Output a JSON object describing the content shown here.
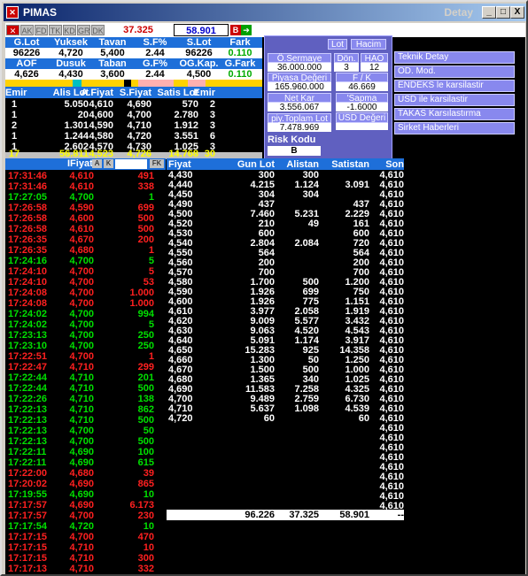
{
  "window": {
    "title": "PIMAS",
    "subtitle": "Detay",
    "btn_min": "_",
    "btn_max": "□",
    "btn_close": "X"
  },
  "toolbar": {
    "tabs": [
      "AK",
      "FD",
      "TK",
      "KD",
      "GR",
      "DK"
    ],
    "value_red": "37.325",
    "value_blue": "58.901",
    "b_label": "B"
  },
  "summary": {
    "h1": [
      "G.Lot",
      "Yuksek",
      "Tavan",
      "S.F%",
      "S.Lot",
      "Fark"
    ],
    "v1": [
      "96226",
      "4,720",
      "5,400",
      "2.44",
      "96226",
      "0.110"
    ],
    "h2": [
      "AOF",
      "Dusuk",
      "Taban",
      "G.F%",
      "OG.Kap.",
      "G.Fark"
    ],
    "v2": [
      "4,626",
      "4,430",
      "3,600",
      "2.44",
      "4,500",
      "0.110"
    ]
  },
  "depth": {
    "headers": [
      "Emir",
      "Alis Lot",
      "A.Fiyat",
      "S.Fiyat",
      "Satis Lot",
      "Emir"
    ],
    "rows": [
      [
        "1",
        "5.050",
        "4,610",
        "4,690",
        "570",
        "2"
      ],
      [
        "1",
        "20",
        "4,600",
        "4,700",
        "2.780",
        "3"
      ],
      [
        "2",
        "1.301",
        "4,590",
        "4,710",
        "1.912",
        "3"
      ],
      [
        "1",
        "1.244",
        "4,580",
        "4,720",
        "3.551",
        "6"
      ],
      [
        "1",
        "2.602",
        "4,570",
        "4,730",
        "1.025",
        "3"
      ]
    ],
    "total": [
      "17",
      "56.811",
      "4,523",
      "4,726",
      "14.768",
      "30"
    ]
  },
  "panel": {
    "lot": "Lot",
    "hacim": "Hacim",
    "osermaye": "Ö.Sermaye",
    "osermaye_v": "36.000.000",
    "don": "Dön.",
    "don_v": "3",
    "hao": "HAO",
    "hao_v": "12",
    "piyasa": "Piyasa Değeri",
    "piyasa_v": "165.960.000",
    "fk": "F / K",
    "fk_v": "46.669",
    "netkar": "Net Kar",
    "netkar_v": "3.556.067",
    "sapma": "'Sapma",
    "sapma_v": "-1.6000",
    "piytop": "piy.Toplam Lot",
    "piytop_v": "7.478.969",
    "usd": "USD Değeri",
    "risk": "Risk Kodu",
    "risk_v": "B"
  },
  "links": [
    "Teknik Detay",
    "OD. Mod.",
    "ENDEKS le karsilastir",
    "USD ile karsilastir",
    "TAKAS Karsılastırma",
    "Sirket Haberleri"
  ],
  "trades_header": {
    "ifiyat": "IFiyat",
    "a": "A",
    "k": "K",
    "fk": "FK"
  },
  "trades": [
    [
      "17:31:46",
      "4,610",
      "491",
      "r"
    ],
    [
      "17:31:46",
      "4,610",
      "338",
      "r"
    ],
    [
      "17:27:05",
      "4,700",
      "1",
      "g"
    ],
    [
      "17:26:58",
      "4,590",
      "699",
      "r"
    ],
    [
      "17:26:58",
      "4,600",
      "500",
      "r"
    ],
    [
      "17:26:58",
      "4,610",
      "500",
      "r"
    ],
    [
      "17:26:35",
      "4,670",
      "200",
      "r"
    ],
    [
      "17:26:35",
      "4,680",
      "1",
      "r"
    ],
    [
      "17:24:16",
      "4,700",
      "5",
      "g"
    ],
    [
      "17:24:10",
      "4,700",
      "5",
      "r"
    ],
    [
      "17:24:10",
      "4,700",
      "53",
      "r"
    ],
    [
      "17:24:08",
      "4,700",
      "1.000",
      "r"
    ],
    [
      "17:24:08",
      "4,700",
      "1.000",
      "r"
    ],
    [
      "17:24:02",
      "4,700",
      "994",
      "g"
    ],
    [
      "17:24:02",
      "4,700",
      "5",
      "g"
    ],
    [
      "17:23:13",
      "4,700",
      "250",
      "g"
    ],
    [
      "17:23:10",
      "4,700",
      "250",
      "g"
    ],
    [
      "17:22:51",
      "4,700",
      "1",
      "r"
    ],
    [
      "17:22:47",
      "4,710",
      "299",
      "r"
    ],
    [
      "17:22:44",
      "4,710",
      "201",
      "g"
    ],
    [
      "17:22:44",
      "4,710",
      "500",
      "g"
    ],
    [
      "17:22:26",
      "4,710",
      "138",
      "g"
    ],
    [
      "17:22:13",
      "4,710",
      "862",
      "g"
    ],
    [
      "17:22:13",
      "4,710",
      "500",
      "g"
    ],
    [
      "17:22:13",
      "4,700",
      "50",
      "g"
    ],
    [
      "17:22:13",
      "4,700",
      "500",
      "g"
    ],
    [
      "17:22:11",
      "4,690",
      "100",
      "g"
    ],
    [
      "17:22:11",
      "4,690",
      "615",
      "g"
    ],
    [
      "17:22:00",
      "4,680",
      "39",
      "r"
    ],
    [
      "17:20:02",
      "4,690",
      "865",
      "r"
    ],
    [
      "17:19:55",
      "4,690",
      "10",
      "g"
    ],
    [
      "17:17:57",
      "4,690",
      "6.173",
      "r"
    ],
    [
      "17:17:57",
      "4,700",
      "230",
      "r"
    ],
    [
      "17:17:54",
      "4,720",
      "10",
      "g"
    ],
    [
      "17:17:15",
      "4,700",
      "470",
      "r"
    ],
    [
      "17:17:15",
      "4,710",
      "10",
      "r"
    ],
    [
      "17:17:15",
      "4,710",
      "300",
      "r"
    ],
    [
      "17:17:13",
      "4,710",
      "332",
      "r"
    ]
  ],
  "grid_header": [
    "Fiyat",
    "Gun Lot",
    "Alistan",
    "Satistan",
    "Son"
  ],
  "grid": [
    [
      "4,430",
      "300",
      "300",
      "",
      "4,610"
    ],
    [
      "4,440",
      "4.215",
      "1.124",
      "3.091",
      "4,610"
    ],
    [
      "4,450",
      "304",
      "304",
      "",
      "4,610"
    ],
    [
      "4,490",
      "437",
      "",
      "437",
      "4,610"
    ],
    [
      "4,500",
      "7.460",
      "5.231",
      "2.229",
      "4,610"
    ],
    [
      "4,520",
      "210",
      "49",
      "161",
      "4,610"
    ],
    [
      "4,530",
      "600",
      "",
      "600",
      "4,610"
    ],
    [
      "4,540",
      "2.804",
      "2.084",
      "720",
      "4,610"
    ],
    [
      "4,550",
      "564",
      "",
      "564",
      "4,610"
    ],
    [
      "4,560",
      "200",
      "",
      "200",
      "4,610"
    ],
    [
      "4,570",
      "700",
      "",
      "700",
      "4,610"
    ],
    [
      "4,580",
      "1.700",
      "500",
      "1.200",
      "4,610"
    ],
    [
      "4,590",
      "1.926",
      "699",
      "750",
      "4,610"
    ],
    [
      "4,600",
      "1.926",
      "775",
      "1.151",
      "4,610"
    ],
    [
      "4,610",
      "3.977",
      "2.058",
      "1.919",
      "4,610"
    ],
    [
      "4,620",
      "9.009",
      "5.577",
      "3.432",
      "4,610"
    ],
    [
      "4,630",
      "9.063",
      "4.520",
      "4.543",
      "4,610"
    ],
    [
      "4,640",
      "5.091",
      "1.174",
      "3.917",
      "4,610"
    ],
    [
      "4,650",
      "15.283",
      "925",
      "14.358",
      "4,610"
    ],
    [
      "4,660",
      "1.300",
      "50",
      "1.250",
      "4,610"
    ],
    [
      "4,670",
      "1.500",
      "500",
      "1.000",
      "4,610"
    ],
    [
      "4,680",
      "1.365",
      "340",
      "1.025",
      "4,610"
    ],
    [
      "4,690",
      "11.583",
      "7.258",
      "4.325",
      "4,610"
    ],
    [
      "4,700",
      "9.489",
      "2.759",
      "6.730",
      "4,610"
    ],
    [
      "4,710",
      "5.637",
      "1.098",
      "4.539",
      "4,610"
    ],
    [
      "4,720",
      "60",
      "",
      "60",
      "4,610"
    ],
    [
      "",
      "",
      "",
      "",
      "4,610"
    ],
    [
      "",
      "",
      "",
      "",
      "4,610"
    ],
    [
      "",
      "",
      "",
      "",
      "4,610"
    ],
    [
      "",
      "",
      "",
      "",
      "4,610"
    ],
    [
      "",
      "",
      "",
      "",
      "4,610"
    ],
    [
      "",
      "",
      "",
      "",
      "4,610"
    ],
    [
      "",
      "",
      "",
      "",
      "4,610"
    ],
    [
      "",
      "",
      "",
      "",
      "4,610"
    ],
    [
      "",
      "",
      "",
      "",
      "4,610"
    ]
  ],
  "grid_total": [
    "96.226",
    "37.325",
    "58.901",
    "--"
  ]
}
